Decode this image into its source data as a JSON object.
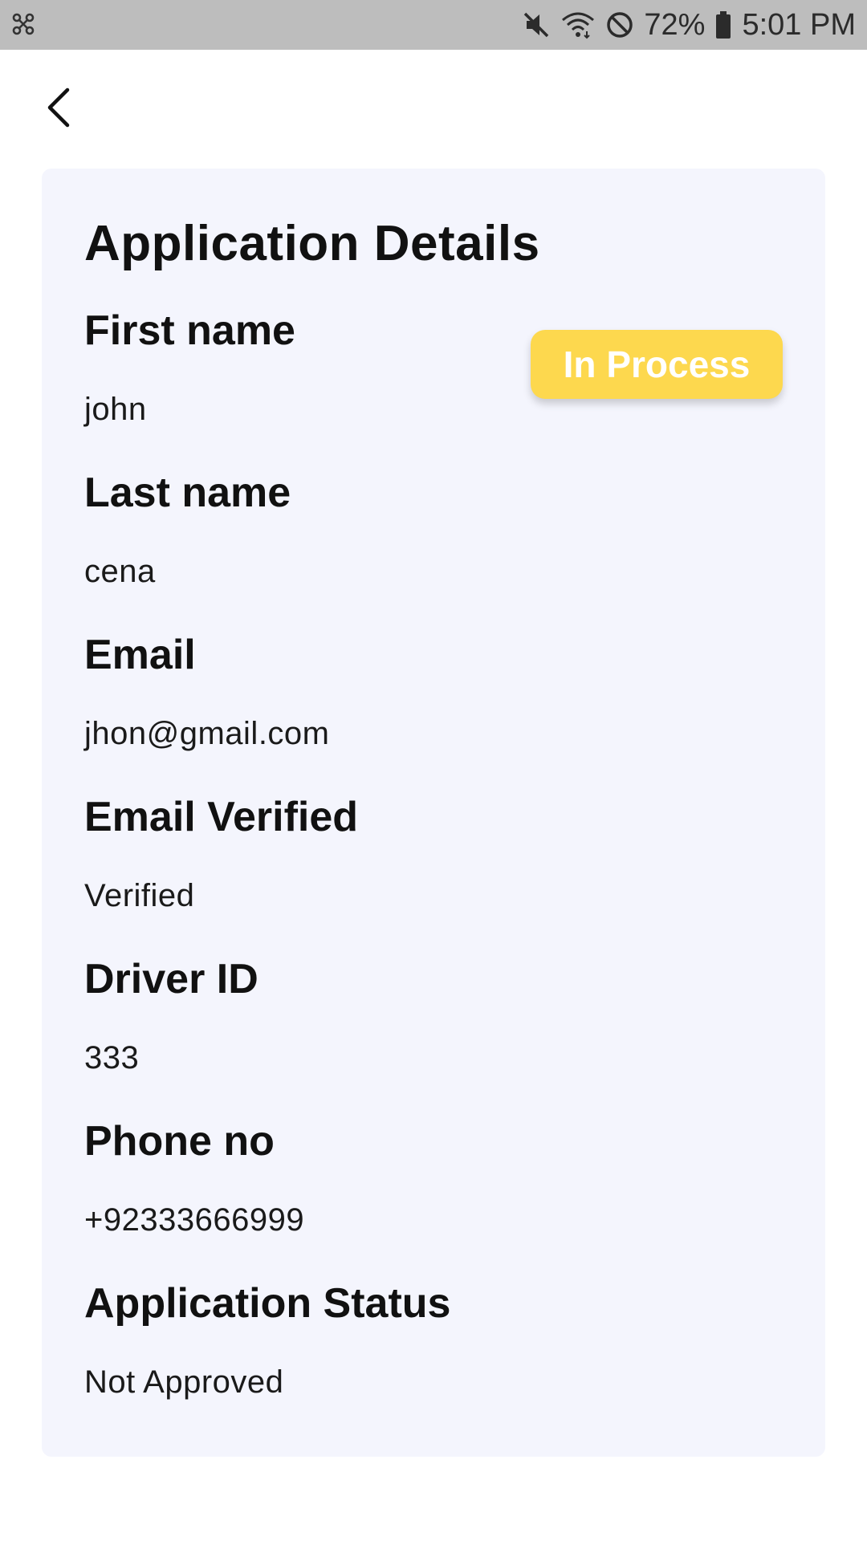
{
  "status_bar": {
    "battery": "72%",
    "time": "5:01 PM",
    "icons": [
      "app-notification-icon",
      "mute-icon",
      "wifi-icon",
      "do-not-disturb-icon",
      "battery-icon"
    ]
  },
  "header": {
    "back_icon": "chevron-left-icon"
  },
  "card": {
    "title": "Application Details",
    "status_chip": {
      "label": "In Process",
      "color": "#fdd84e",
      "text_color": "#ffffff"
    },
    "fields": [
      {
        "label": "First name",
        "value": "john"
      },
      {
        "label": "Last name",
        "value": "cena"
      },
      {
        "label": "Email",
        "value": "jhon@gmail.com"
      },
      {
        "label": "Email Verified",
        "value": "Verified"
      },
      {
        "label": "Driver ID",
        "value": "333"
      },
      {
        "label": "Phone no",
        "value": "+92333666999"
      },
      {
        "label": "Application Status",
        "value": "Not Approved"
      }
    ],
    "background": "#f4f5fd"
  }
}
